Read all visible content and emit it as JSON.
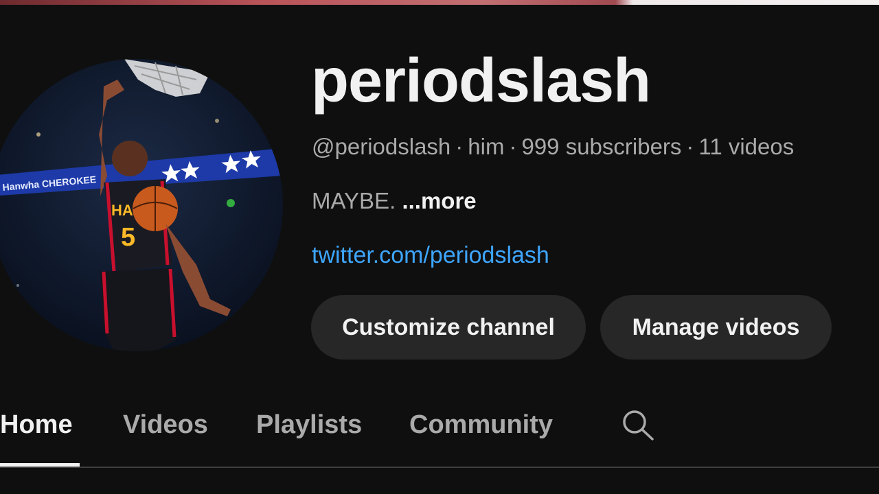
{
  "channel": {
    "name": "periodslash",
    "handle": "@periodslash",
    "pronoun": "him",
    "subscribers": "999 subscribers",
    "video_count": "11 videos",
    "separator": "·",
    "description": "MAYBE.",
    "more_label": "...more",
    "link": "twitter.com/periodslash",
    "avatar_icon": "channel-avatar-basketball-dunk-photo"
  },
  "actions": {
    "customize_label": "Customize channel",
    "manage_label": "Manage videos"
  },
  "tabs": [
    {
      "label": "Home",
      "active": true
    },
    {
      "label": "Videos",
      "active": false
    },
    {
      "label": "Playlists",
      "active": false
    },
    {
      "label": "Community",
      "active": false
    }
  ],
  "search_icon": "search-icon",
  "colors": {
    "background": "#0f0f0f",
    "button_bg": "#272727",
    "link": "#3ea6ff",
    "text_primary": "#f1f1f1",
    "text_secondary": "#aaaaaa"
  }
}
